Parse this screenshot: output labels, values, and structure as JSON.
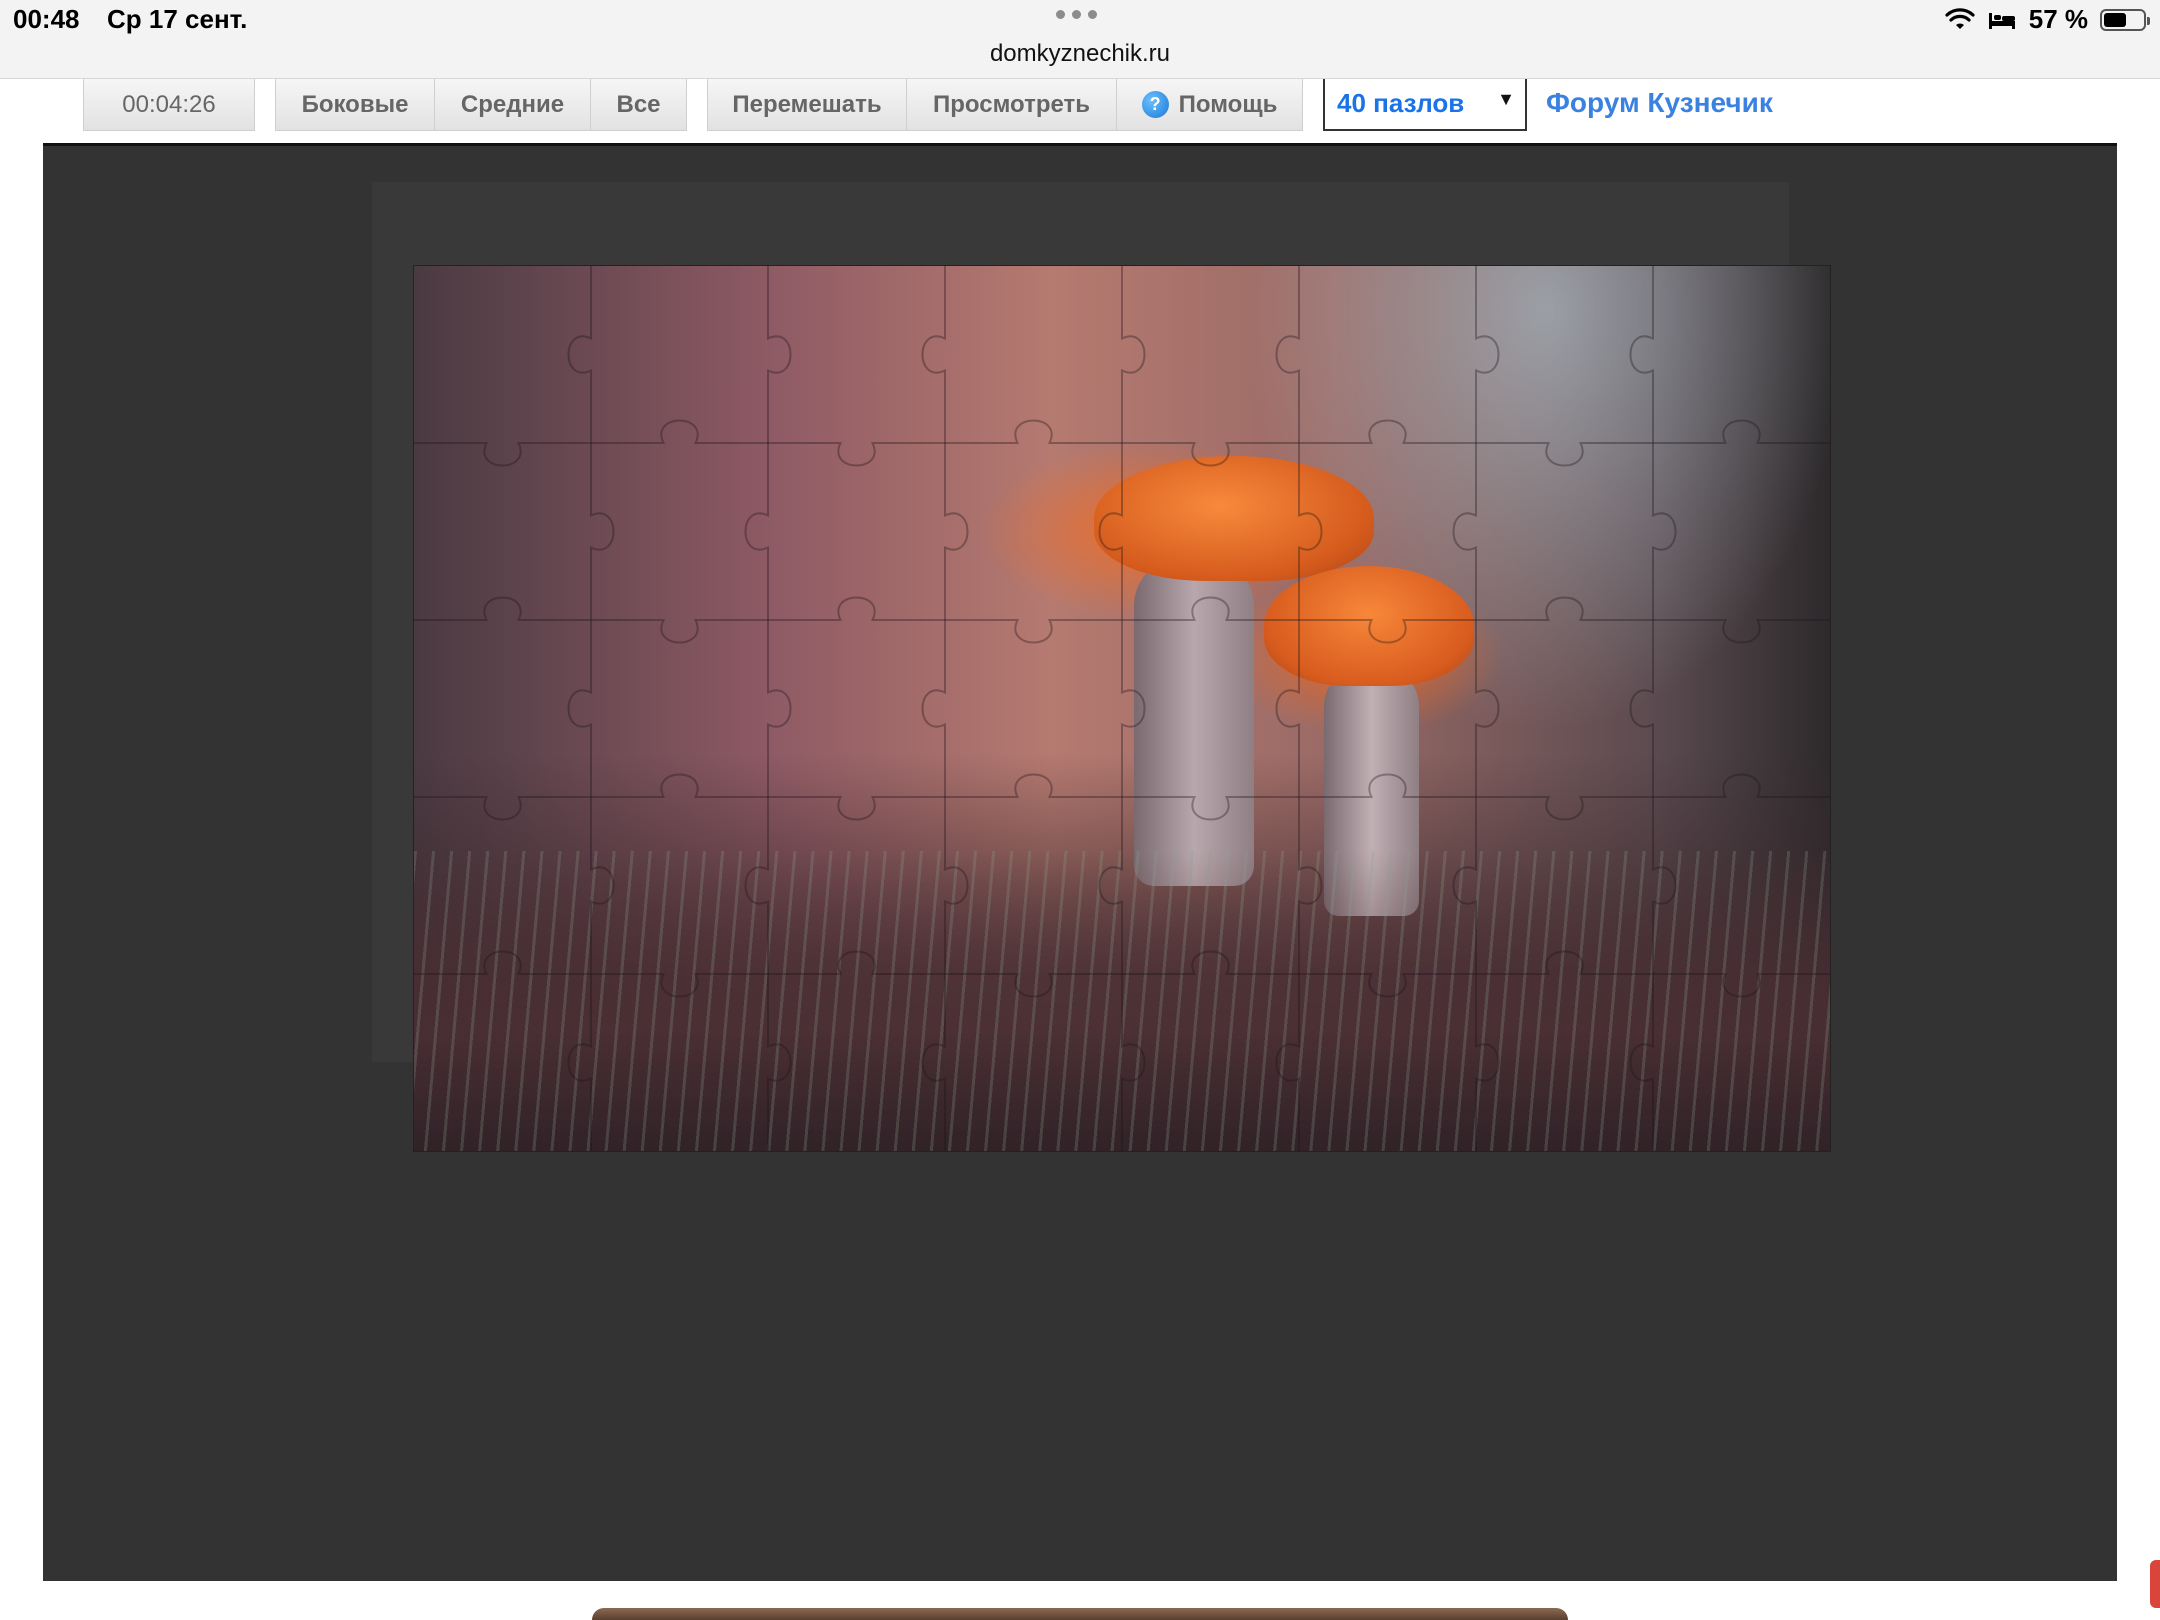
{
  "status_bar": {
    "time": "00:48",
    "date": "Ср 17 сент.",
    "url": "domkyznechik.ru",
    "battery_percent": "57 %",
    "battery_level": 0.57,
    "icons": [
      "wifi-icon",
      "bed-icon",
      "battery-icon"
    ]
  },
  "toolbar": {
    "timer": "00:04:26",
    "filter_buttons": [
      "Боковые",
      "Средние",
      "Все"
    ],
    "shuffle_label": "Перемешать",
    "preview_label": "Просмотреть",
    "help_label": "Помощь",
    "pieces_select": {
      "selected": "40 пазлов"
    },
    "forum_link": "Форум Кузнечик"
  },
  "puzzle": {
    "columns": 8,
    "rows": 5,
    "image_subject": "two orange-cap mushrooms in moss",
    "board_color": "#333333"
  },
  "colors": {
    "accent_link": "#3b82e0",
    "select_text": "#1a73e8",
    "board": "#333333"
  }
}
